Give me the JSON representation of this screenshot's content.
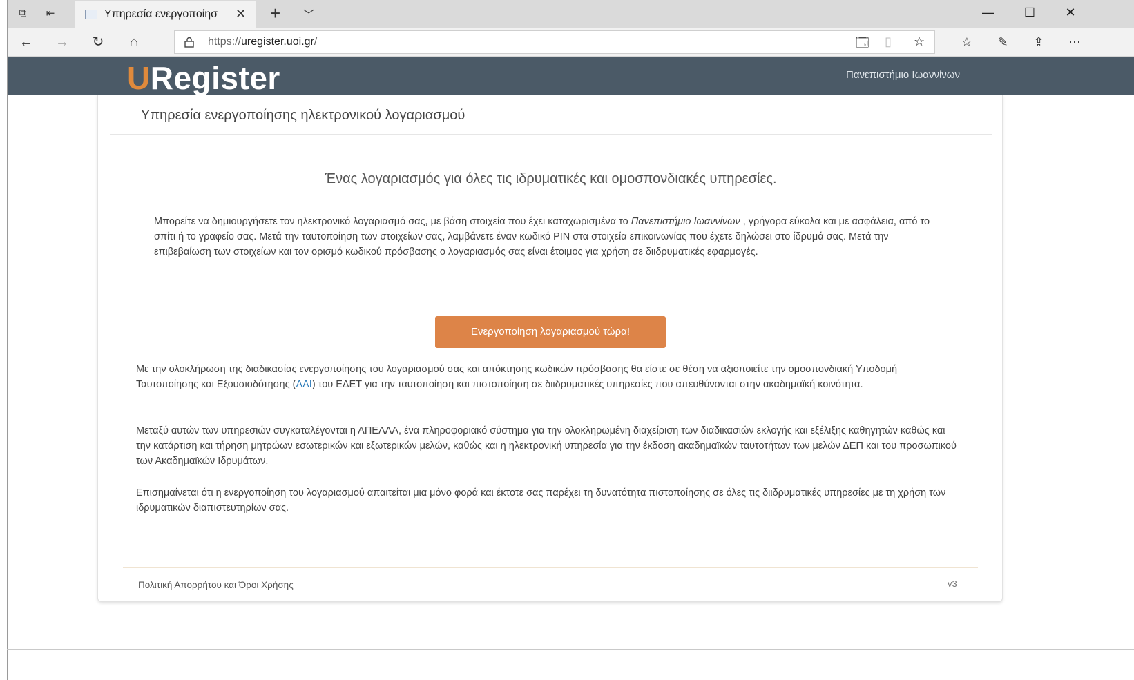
{
  "browser": {
    "tab_title": "Υπηρεσία ενεργοποίησ",
    "url_prefix": "https://",
    "url_host": "uregister.uoi.gr",
    "url_suffix": "/"
  },
  "header": {
    "logo_u": "U",
    "logo_rest": "Register",
    "institution": "Πανεπιστήμιο Ιωαννίνων",
    "brand_color": "#e08a3c",
    "bar_color": "#4b5a67"
  },
  "card": {
    "title": "Υπηρεσία ενεργοποίησης ηλεκτρονικού λογαριασμού",
    "headline": "Ένας λογαριασμός για όλες τις ιδρυματικές και ομοσπονδιακές υπηρεσίες.",
    "intro_a": "Μπορείτε να δημιουργήσετε τον ηλεκτρονικό λογαριασμό σας, με βάση στοιχεία που έχει καταχωρισμένα το ",
    "intro_em": "Πανεπιστήμιο Ιωαννίνων",
    "intro_b": " , γρήγορα εύκολα και με ασφάλεια, από το σπίτι ή το γραφείο σας. Μετά την ταυτοποίηση των στοιχείων σας, λαμβάνετε έναν κωδικό PIN στα στοιχεία επικοινωνίας που έχετε δηλώσει στο ίδρυμά σας. Μετά την επιβεβαίωση των στοιχείων και τον ορισμό κωδικού πρόσβασης ο λογαριασμός σας είναι έτοιμος για χρήση σε διιδρυματικές εφαρμογές.",
    "activate_button": "Ενεργοποίηση λογαριασμού τώρα!",
    "para1_a": "Με την ολοκλήρωση της διαδικασίας ενεργοποίησης του λογαριασμού σας και απόκτησης κωδικών πρόσβασης θα είστε σε θέση να αξιοποιείτε την ομοσπονδιακή Υποδομή Ταυτοποίησης και Εξουσιοδότησης (",
    "para1_link": "AAI",
    "para1_b": ") του ΕΔΕΤ για την ταυτοποίηση και πιστοποίηση σε διιδρυματικές υπηρεσίες που απευθύνονται στην ακαδημαϊκή κοινότητα.",
    "para2": "Μεταξύ αυτών των υπηρεσιών συγκαταλέγονται η ΑΠΕΛΛΑ, ένα πληροφοριακό σύστημα για την ολοκληρωμένη διαχείριση των διαδικασιών εκλογής και εξέλιξης καθηγητών καθώς και την κατάρτιση και τήρηση μητρώων εσωτερικών και εξωτερικών μελών, καθώς και η ηλεκτρονική υπηρεσία για την έκδοση ακαδημαϊκών ταυτοτήτων των μελών ΔΕΠ και του προσωπικού των Ακαδημαϊκών Ιδρυμάτων.",
    "para3": "Επισημαίνεται ότι η ενεργοποίηση του λογαριασμού απαιτείται μια μόνο φορά και έκτοτε σας παρέχει τη δυνατότητα πιστοποίησης σε όλες τις διιδρυματικές υπηρεσίες με τη χρήση των ιδρυματικών διαπιστευτηρίων σας.",
    "footer_link": "Πολιτική Απορρήτου και Όροι Χρήσης",
    "version": "v3",
    "button_color": "#dd8448"
  },
  "icons": {
    "tab_actions": "tabs-aside-icon",
    "back": "back-arrow-icon",
    "forward": "forward-arrow-icon",
    "refresh": "refresh-icon",
    "home": "home-icon"
  }
}
